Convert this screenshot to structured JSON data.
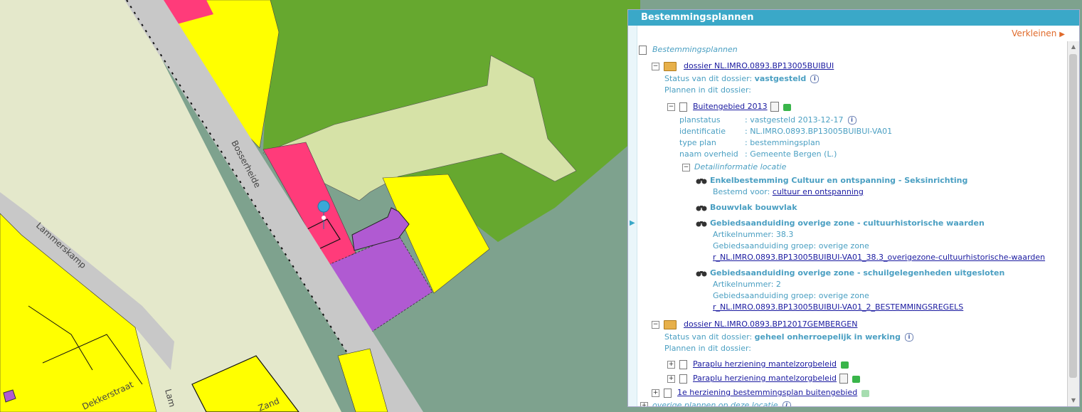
{
  "colors": {
    "header": "#3aa8c8",
    "link": "#1a1aa0",
    "text": "#4a9fc2",
    "collapse": "#e06a2a"
  },
  "map": {
    "street_labels": [
      "Bosserheide",
      "Lammerskamp",
      "Dekkerstraat",
      "Zand",
      "Lam"
    ]
  },
  "panel": {
    "title": "Bestemmingsplannen",
    "collapse_label": "Verkleinen",
    "root_label": "Bestemmingsplannen",
    "dossier1": {
      "name": "dossier NL.IMRO.0893.BP13005BUIBUI",
      "status_label": "Status van dit dossier:",
      "status_value": "vastgesteld",
      "plans_label": "Plannen in dit dossier:",
      "plan": {
        "name": "Buitengebied 2013",
        "fields": [
          {
            "key": "planstatus",
            "value": ": vastgesteld 2013-12-17"
          },
          {
            "key": "identificatie",
            "value": ": NL.IMRO.0893.BP13005BUIBUI-VA01"
          },
          {
            "key": "type plan",
            "value": ": bestemmingsplan"
          },
          {
            "key": "naam overheid",
            "value": ": Gemeente Bergen (L.)"
          }
        ],
        "detail_label": "Detailinformatie locatie",
        "details": {
          "d1_title": "Enkelbestemming Cultuur en ontspanning - Seksinrichting",
          "d1_line_label": "Bestemd voor:",
          "d1_line_link": "cultuur en ontspanning",
          "d2_title": "Bouwvlak bouwvlak",
          "d3_title": "Gebiedsaanduiding overige zone - cultuurhistorische waarden",
          "d3_art": "Artikelnummer: 38.3",
          "d3_group": "Gebiedsaanduiding groep: overige zone",
          "d3_link": "r_NL.IMRO.0893.BP13005BUIBUI-VA01_38.3_overigezone-cultuurhistorische-waarden",
          "d4_title": "Gebiedsaanduiding overige zone - schuilgelegenheden uitgesloten",
          "d4_art": "Artikelnummer: 2",
          "d4_group": "Gebiedsaanduiding groep: overige zone",
          "d4_link": "r_NL.IMRO.0893.BP13005BUIBUI-VA01_2_BESTEMMINGSREGELS"
        }
      }
    },
    "dossier2": {
      "name": "dossier NL.IMRO.0893.BP12017GEMBERGEN",
      "status_label": "Status van dit dossier:",
      "status_value": "geheel onherroepelijk in werking",
      "plans_label": "Plannen in dit dossier:",
      "plan1": "Paraplu herziening mantelzorgbeleid",
      "plan2": "Paraplu herziening mantelzorgbeleid"
    },
    "item3": "1e herziening bestemmingsplan buitengebied",
    "item4": "overige plannen op deze locatie"
  }
}
